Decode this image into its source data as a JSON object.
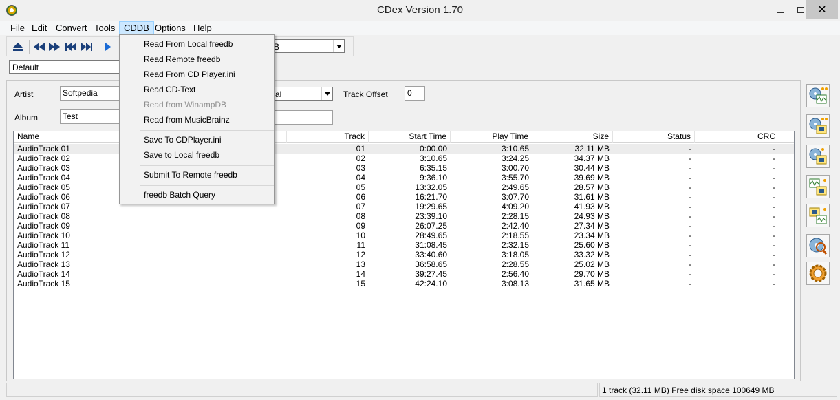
{
  "window": {
    "title": "CDex Version 1.70"
  },
  "menubar": {
    "items": [
      "File",
      "Edit",
      "Convert",
      "Tools",
      "CDDB",
      "Options",
      "Help"
    ],
    "active": "CDDB"
  },
  "toolbar": {
    "drive_combo_value": "B"
  },
  "profile_combo": {
    "value": "Default"
  },
  "form": {
    "artist_label": "Artist",
    "artist_value": "Softpedia",
    "album_label": "Album",
    "album_value": "Test",
    "genre_combo_value": "al",
    "track_offset_label": "Track Offset",
    "track_offset_value": "0"
  },
  "track_list": {
    "columns": [
      "Name",
      "Track",
      "Start Time",
      "Play Time",
      "Size",
      "Status",
      "CRC"
    ],
    "rows": [
      [
        "AudioTrack 01",
        "01",
        "0:00.00",
        "3:10.65",
        "32.11 MB",
        "-",
        "-"
      ],
      [
        "AudioTrack 02",
        "02",
        "3:10.65",
        "3:24.25",
        "34.37 MB",
        "-",
        "-"
      ],
      [
        "AudioTrack 03",
        "03",
        "6:35.15",
        "3:00.70",
        "30.44 MB",
        "-",
        "-"
      ],
      [
        "AudioTrack 04",
        "04",
        "9:36.10",
        "3:55.70",
        "39.69 MB",
        "-",
        "-"
      ],
      [
        "AudioTrack 05",
        "05",
        "13:32.05",
        "2:49.65",
        "28.57 MB",
        "-",
        "-"
      ],
      [
        "AudioTrack 06",
        "06",
        "16:21.70",
        "3:07.70",
        "31.61 MB",
        "-",
        "-"
      ],
      [
        "AudioTrack 07",
        "07",
        "19:29.65",
        "4:09.20",
        "41.93 MB",
        "-",
        "-"
      ],
      [
        "AudioTrack 08",
        "08",
        "23:39.10",
        "2:28.15",
        "24.93 MB",
        "-",
        "-"
      ],
      [
        "AudioTrack 09",
        "09",
        "26:07.25",
        "2:42.40",
        "27.34 MB",
        "-",
        "-"
      ],
      [
        "AudioTrack 10",
        "10",
        "28:49.65",
        "2:18.55",
        "23.34 MB",
        "-",
        "-"
      ],
      [
        "AudioTrack 11",
        "11",
        "31:08.45",
        "2:32.15",
        "25.60 MB",
        "-",
        "-"
      ],
      [
        "AudioTrack 12",
        "12",
        "33:40.60",
        "3:18.05",
        "33.32 MB",
        "-",
        "-"
      ],
      [
        "AudioTrack 13",
        "13",
        "36:58.65",
        "2:28.55",
        "25.02 MB",
        "-",
        "-"
      ],
      [
        "AudioTrack 14",
        "14",
        "39:27.45",
        "2:56.40",
        "29.70 MB",
        "-",
        "-"
      ],
      [
        "AudioTrack 15",
        "15",
        "42:24.10",
        "3:08.13",
        "31.65 MB",
        "-",
        "-"
      ]
    ]
  },
  "cddb_menu": {
    "items": [
      {
        "label": "Read From Local freedb",
        "enabled": true
      },
      {
        "label": "Read Remote freedb",
        "enabled": true
      },
      {
        "label": "Read From CD Player.ini",
        "enabled": true
      },
      {
        "label": "Read CD-Text",
        "enabled": true
      },
      {
        "label": "Read from WinampDB",
        "enabled": false
      },
      {
        "label": "Read from MusicBrainz",
        "enabled": true
      },
      {
        "label": "Save To CDPlayer.ini",
        "enabled": true
      },
      {
        "label": "Save to Local freedb",
        "enabled": true
      },
      {
        "label": "Submit To Remote freedb",
        "enabled": true
      },
      {
        "label": "freedb Batch Query",
        "enabled": true
      }
    ]
  },
  "status": {
    "text": "1 track (32.11 MB) Free disk space 100649 MB"
  },
  "icons": {
    "eject": "eject-icon",
    "prev": "rewind-icon",
    "next": "fast-forward-icon",
    "skip_back": "skip-back-icon",
    "skip_forward": "skip-forward-icon",
    "play": "play-icon",
    "right_toolbar": [
      "extract-wav-icon",
      "extract-mp3-icon",
      "extract-partial-icon",
      "wav-to-mp3-icon",
      "mp3-to-wav-icon",
      "cd-info-icon",
      "settings-gear-icon"
    ]
  },
  "colors": {
    "menu_highlight": "#cce8ff",
    "selected_row": "#ececec",
    "disabled_text": "#8d8d8d"
  }
}
